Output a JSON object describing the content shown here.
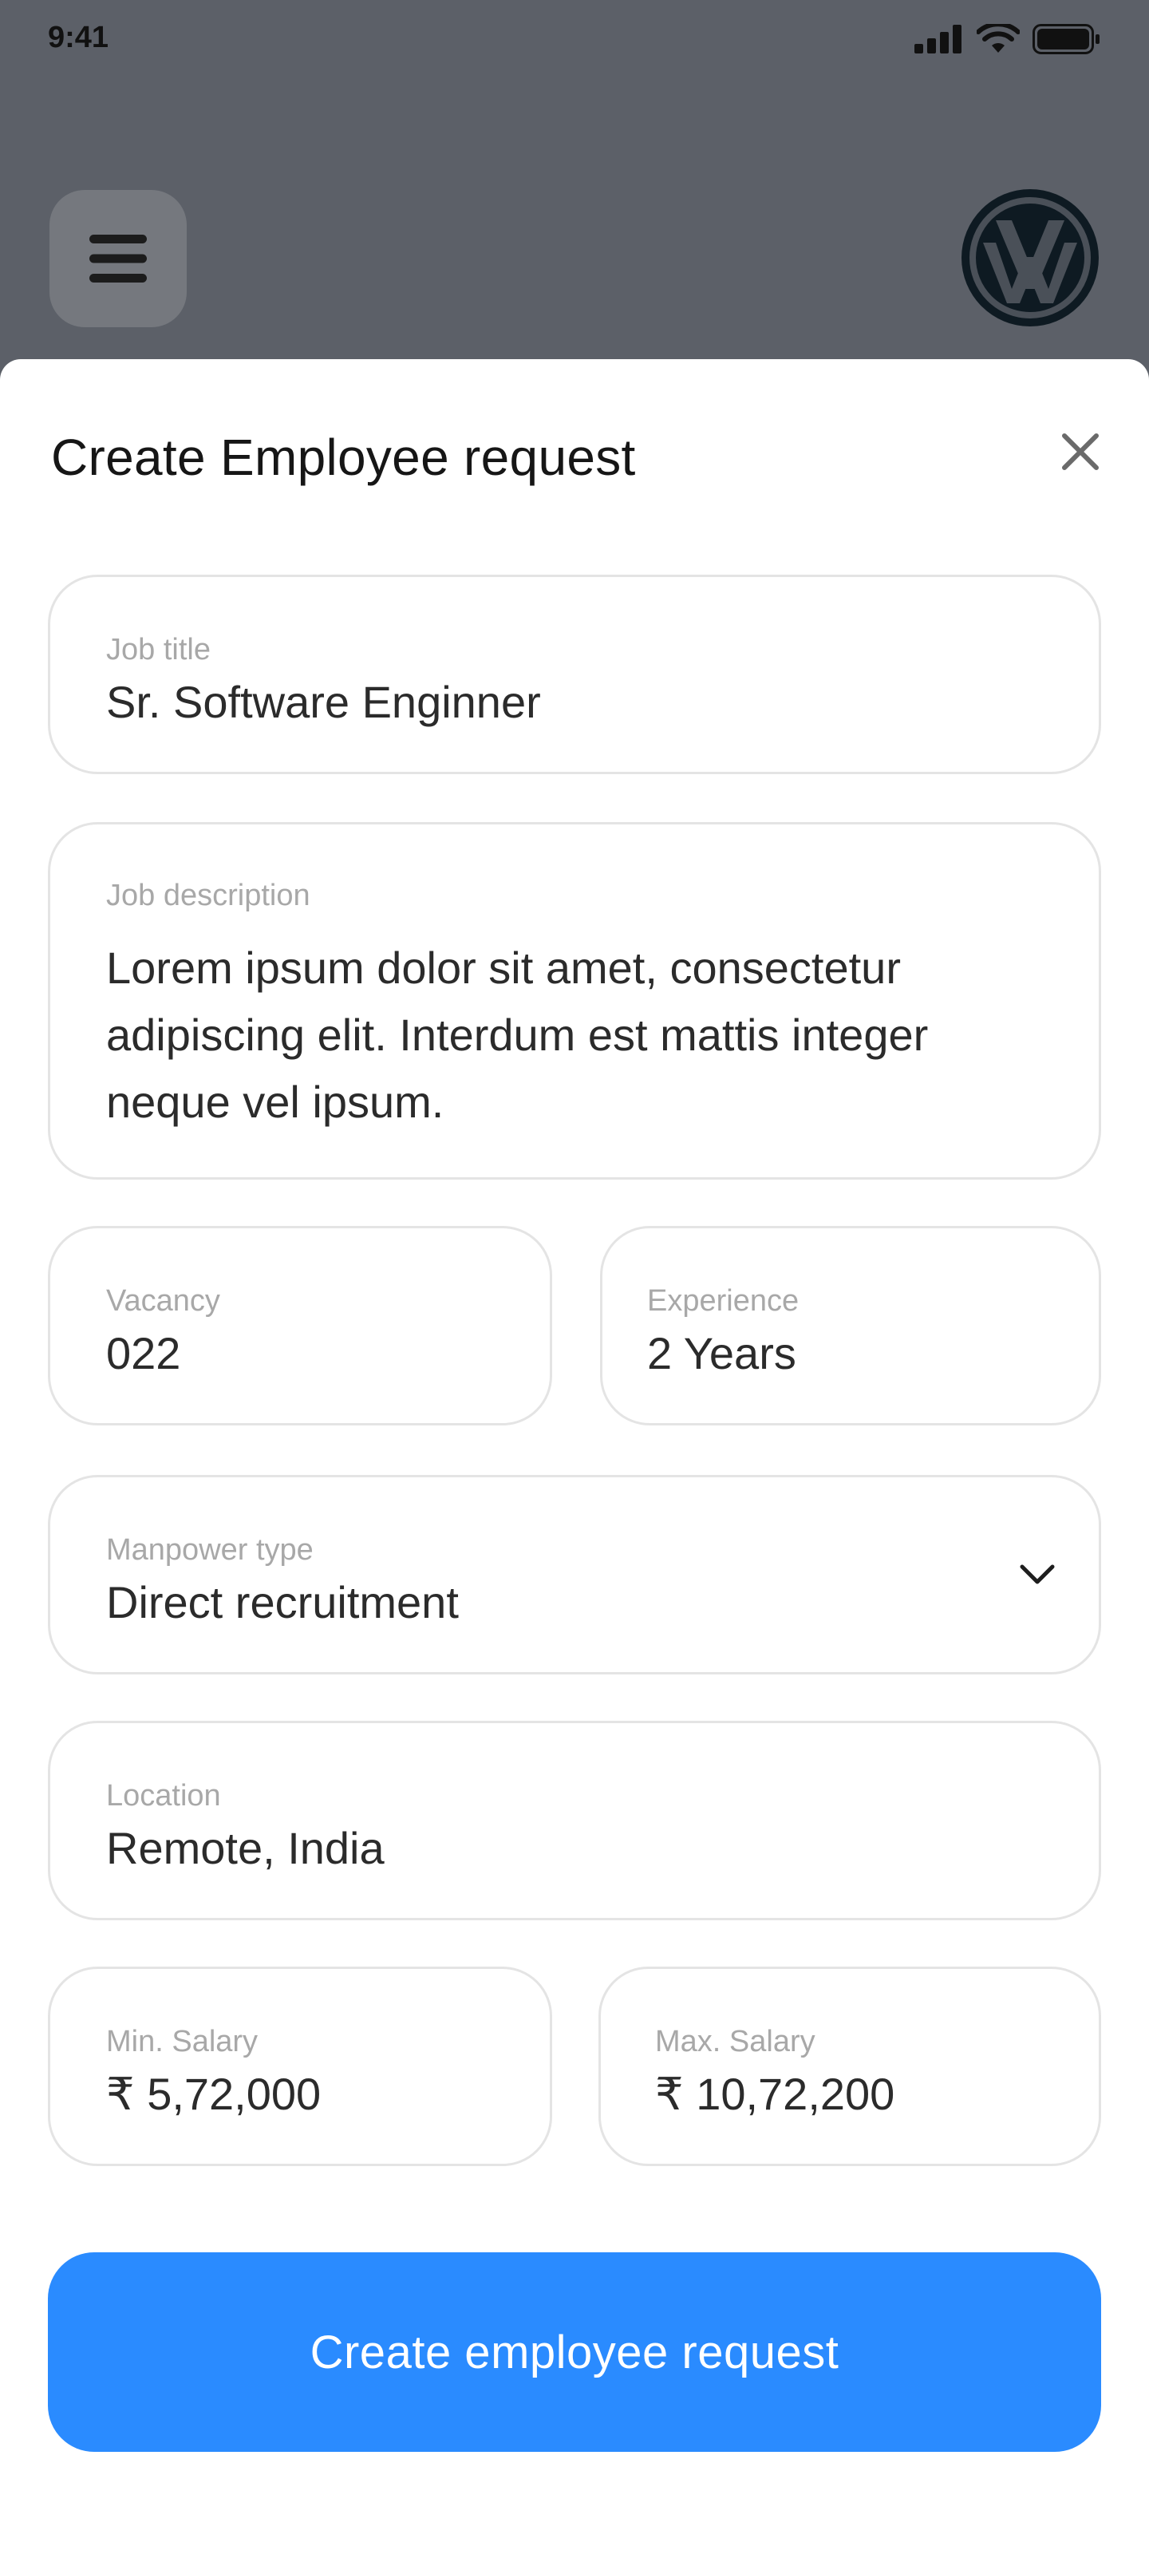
{
  "status_bar": {
    "time": "9:41"
  },
  "header": {
    "menu_icon": "hamburger-menu-icon",
    "logo_icon": "volkswagen-logo"
  },
  "sheet": {
    "title": "Create Employee request",
    "close_icon": "close-icon"
  },
  "form": {
    "job_title": {
      "label": "Job title",
      "value": "Sr. Software Enginner"
    },
    "job_description": {
      "label": "Job description",
      "value": "Lorem ipsum dolor sit amet, consectetur adipiscing elit. Interdum est mattis integer neque vel ipsum."
    },
    "vacancy": {
      "label": "Vacancy",
      "value": "022"
    },
    "experience": {
      "label": "Experience",
      "value": "2 Years"
    },
    "manpower_type": {
      "label": "Manpower type",
      "value": "Direct recruitment"
    },
    "location": {
      "label": "Location",
      "value": "Remote, India"
    },
    "min_salary": {
      "label": "Min. Salary",
      "value": "₹ 5,72,000"
    },
    "max_salary": {
      "label": "Max. Salary",
      "value": "₹ 10,72,200"
    }
  },
  "actions": {
    "submit_label": "Create employee request"
  },
  "colors": {
    "overlay": "#5c6068",
    "primary": "#2a8bff",
    "field_border": "#e4e4e4"
  }
}
